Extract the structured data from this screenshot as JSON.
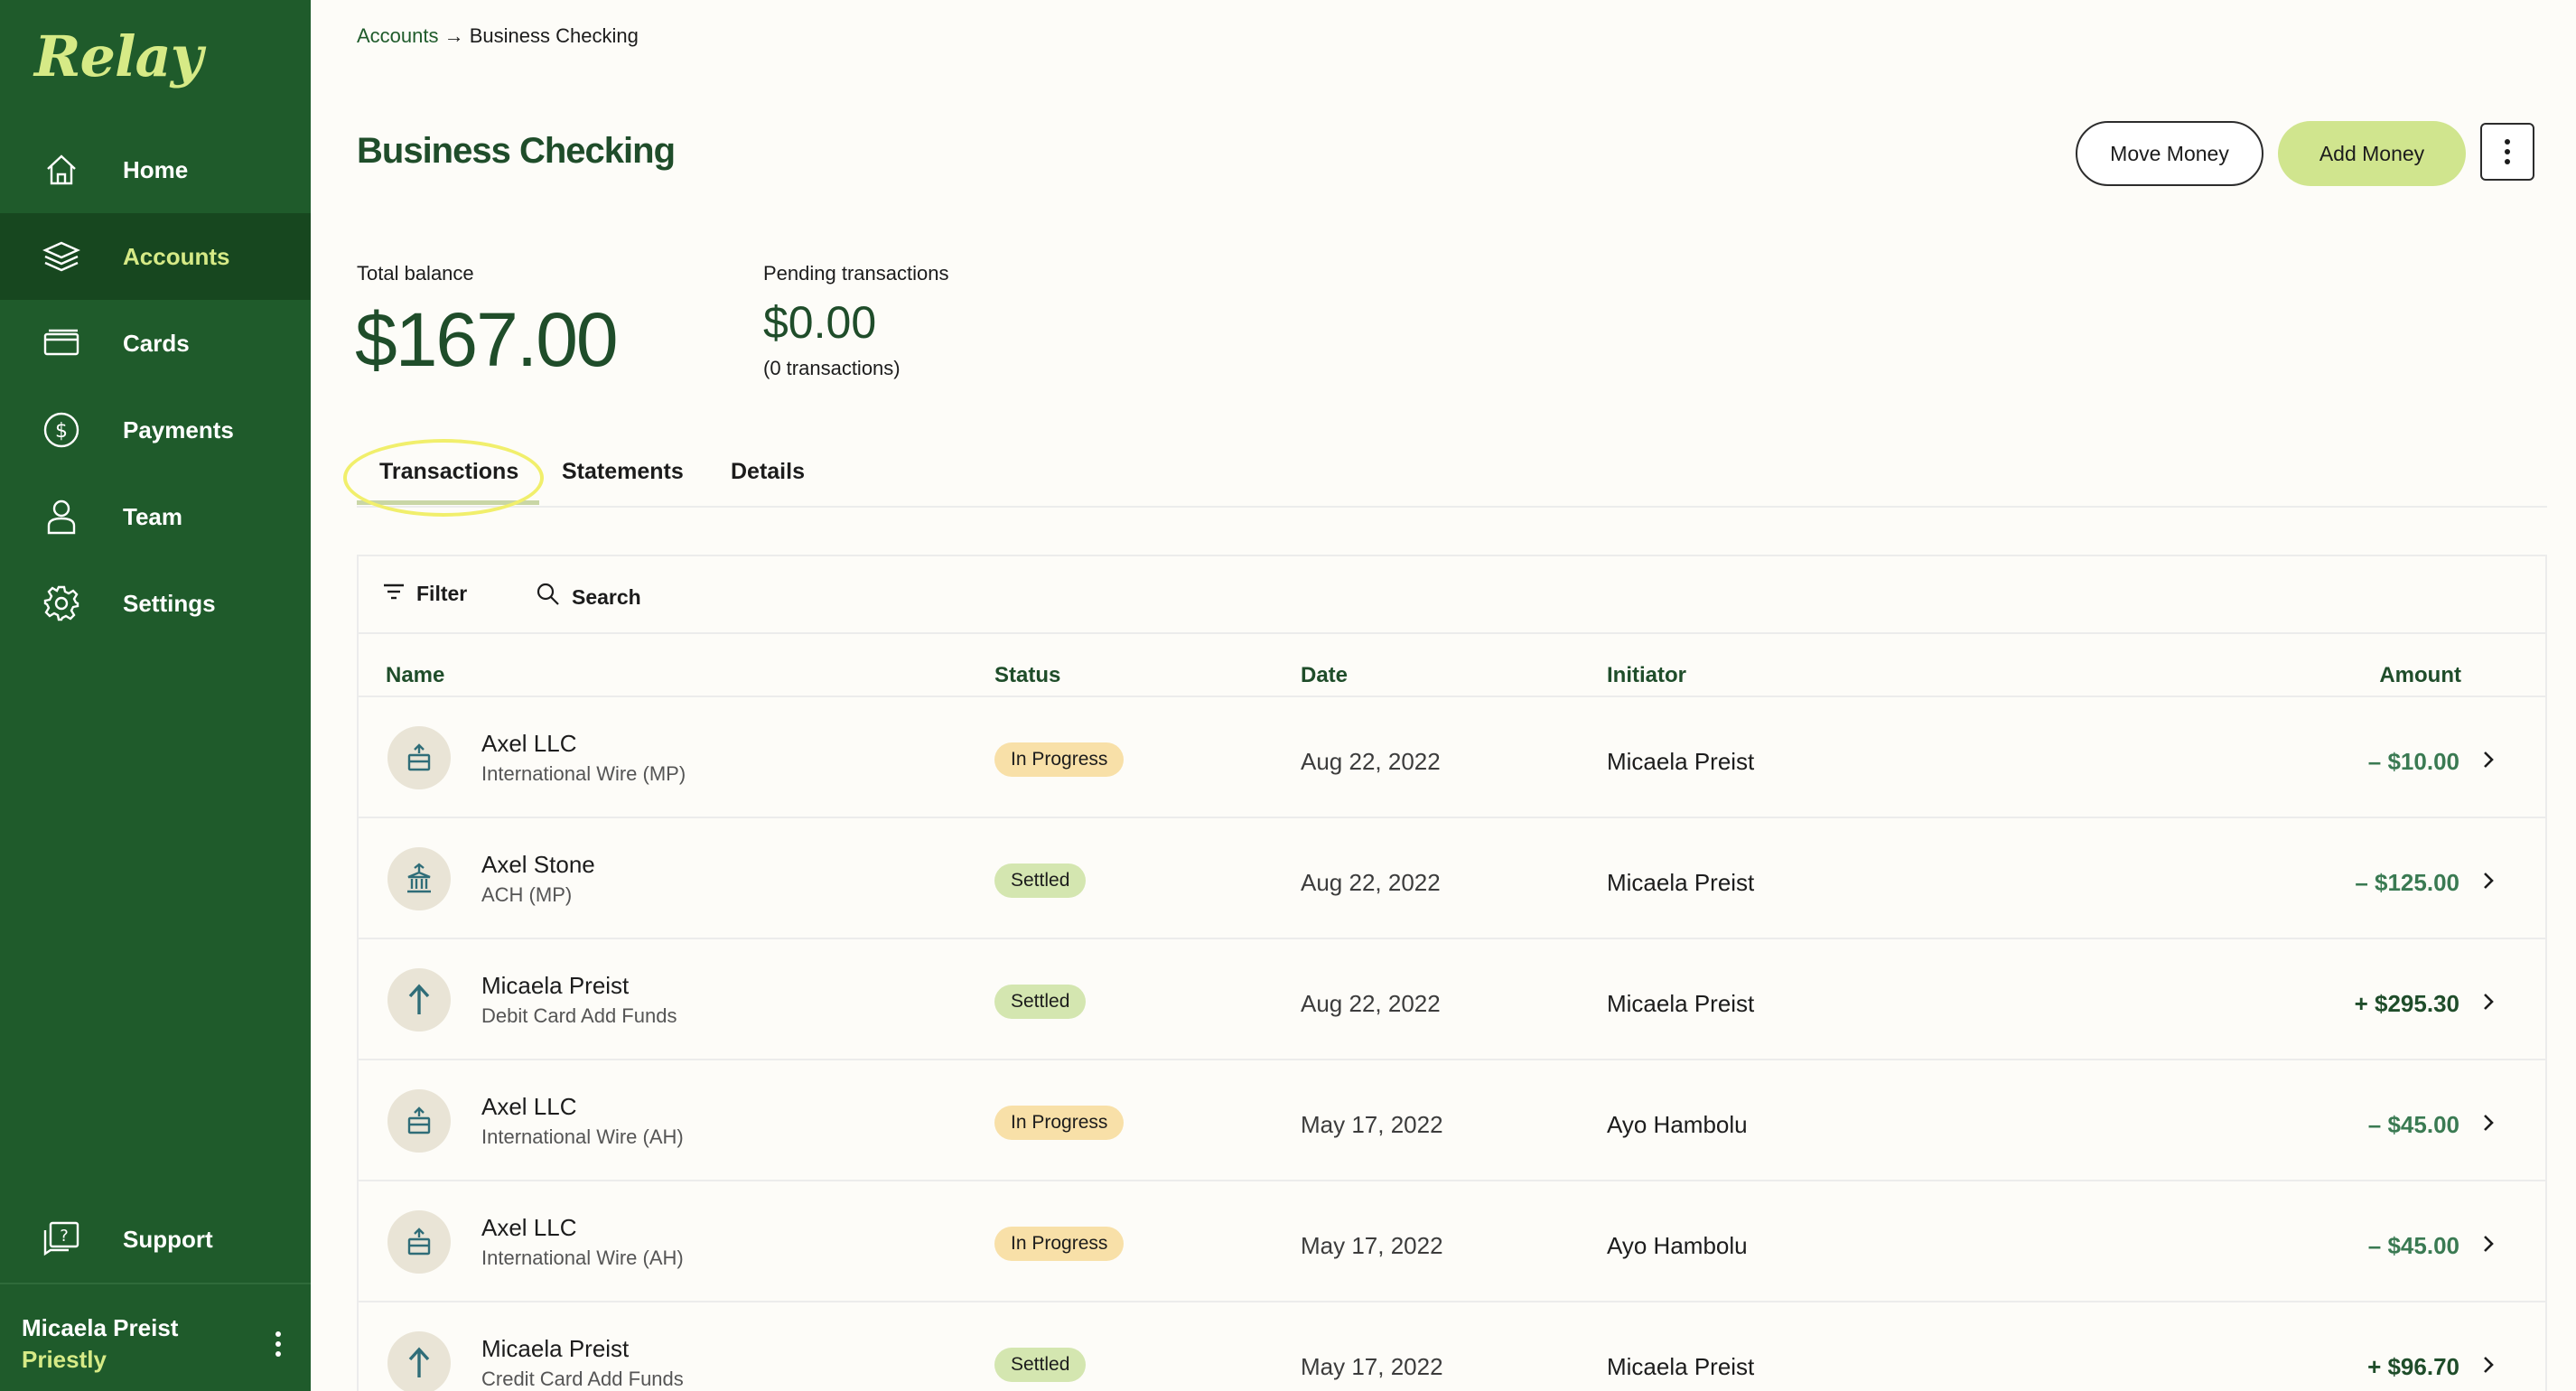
{
  "sidebar": {
    "logo": "Relay",
    "items": [
      {
        "label": "Home",
        "icon": "home-icon"
      },
      {
        "label": "Accounts",
        "icon": "layers-icon",
        "active": true
      },
      {
        "label": "Cards",
        "icon": "card-icon"
      },
      {
        "label": "Payments",
        "icon": "dollar-circle-icon"
      },
      {
        "label": "Team",
        "icon": "person-icon"
      },
      {
        "label": "Settings",
        "icon": "gear-icon"
      }
    ],
    "support": {
      "label": "Support",
      "icon": "help-chat-icon"
    },
    "user": {
      "name": "Micaela Preist",
      "org": "Priestly"
    }
  },
  "breadcrumb": {
    "parent": "Accounts",
    "separator": "→",
    "current": "Business Checking"
  },
  "header": {
    "title": "Business Checking",
    "move_money": "Move Money",
    "add_money": "Add Money"
  },
  "balances": {
    "total_label": "Total balance",
    "total_value": "$167.00",
    "pending_label": "Pending transactions",
    "pending_value": "$0.00",
    "pending_count": "(0 transactions)"
  },
  "tabs": [
    "Transactions",
    "Statements",
    "Details"
  ],
  "toolbar": {
    "filter": "Filter",
    "search": "Search"
  },
  "table": {
    "columns": {
      "name": "Name",
      "status": "Status",
      "date": "Date",
      "initiator": "Initiator",
      "amount": "Amount"
    },
    "rows": [
      {
        "name": "Axel LLC",
        "sub": "International Wire (MP)",
        "status": "In Progress",
        "date": "Aug 22, 2022",
        "initiator": "Micaela Preist",
        "amount": "– $10.00",
        "icon": "wire-icon"
      },
      {
        "name": "Axel Stone",
        "sub": "ACH (MP)",
        "status": "Settled",
        "date": "Aug 22, 2022",
        "initiator": "Micaela Preist",
        "amount": "– $125.00",
        "icon": "bank-icon"
      },
      {
        "name": "Micaela Preist",
        "sub": "Debit Card Add Funds",
        "status": "Settled",
        "date": "Aug 22, 2022",
        "initiator": "Micaela Preist",
        "amount": "+ $295.30",
        "icon": "arrow-up-icon"
      },
      {
        "name": "Axel LLC",
        "sub": "International Wire (AH)",
        "status": "In Progress",
        "date": "May 17, 2022",
        "initiator": "Ayo Hambolu",
        "amount": "– $45.00",
        "icon": "wire-icon"
      },
      {
        "name": "Axel LLC",
        "sub": "International Wire (AH)",
        "status": "In Progress",
        "date": "May 17, 2022",
        "initiator": "Ayo Hambolu",
        "amount": "– $45.00",
        "icon": "wire-icon"
      },
      {
        "name": "Micaela Preist",
        "sub": "Credit Card Add Funds",
        "status": "Settled",
        "date": "May 17, 2022",
        "initiator": "Micaela Preist",
        "amount": "+ $96.70",
        "icon": "arrow-up-icon"
      }
    ]
  },
  "colors": {
    "sidebar": "#1f5b2b",
    "accent": "#d0e58e",
    "brand_text": "#1f4d2a",
    "in_progress": "#f8e0a8",
    "settled": "#d4e6b0"
  }
}
